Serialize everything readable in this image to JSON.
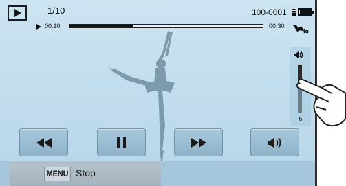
{
  "header": {
    "file_counter": "1/10",
    "file_name": "100-0001",
    "mode_icon": "playback-mode-icon",
    "card_icon": "memory-card-icon",
    "battery_icon": "battery-full-icon"
  },
  "playback": {
    "elapsed_time": "00:10",
    "total_time": "00:30",
    "progress": 0.33,
    "ois_icon": "ois-icon"
  },
  "volume": {
    "icon": "speaker-icon",
    "level": "6",
    "fraction": 0.6
  },
  "controls": [
    {
      "name": "rewind-button",
      "icon": "rewind-icon"
    },
    {
      "name": "pause-button",
      "icon": "pause-icon"
    },
    {
      "name": "fast-forward-button",
      "icon": "fast-forward-icon"
    },
    {
      "name": "volume-button",
      "icon": "speaker-icon"
    }
  ],
  "footer": {
    "menu_key": "MENU",
    "menu_action": "Stop"
  },
  "colors": {
    "screen_bg": "#c3deee",
    "button_bg": "#9ebfd4",
    "silhouette": "#7d9bac",
    "dark": "#111111"
  }
}
